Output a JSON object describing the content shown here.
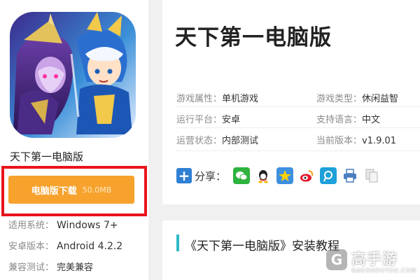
{
  "app": {
    "name": "天下第一电脑版"
  },
  "download": {
    "label": "电脑版下载",
    "size": "50.0MB"
  },
  "specs": [
    {
      "key": "适用系统：",
      "value": "Windows 7+"
    },
    {
      "key": "安卓版本：",
      "value": "Android 4.2.2"
    },
    {
      "key": "兼容测试：",
      "value": "完美兼容"
    }
  ],
  "info": {
    "title": "天下第一电脑版",
    "attributes": [
      {
        "key": "游戏属性：",
        "value": "单机游戏"
      },
      {
        "key": "游戏类型：",
        "value": "休闲益智"
      },
      {
        "key": "运行平台：",
        "value": "安卓"
      },
      {
        "key": "支持语言：",
        "value": "中文"
      },
      {
        "key": "运营状态：",
        "value": "内部测试"
      },
      {
        "key": "当前版本：",
        "value": "v1.9.01"
      }
    ],
    "share": {
      "plus": "+",
      "label": "分享：",
      "icons": [
        "wechat-icon",
        "qq-icon",
        "qzone-icon",
        "weibo-icon",
        "tencent-weibo-icon",
        "print-icon",
        "copy-icon"
      ]
    }
  },
  "tutorial": {
    "title": "《天下第一电脑版》安装教程"
  },
  "watermark": {
    "logo_char": "G",
    "text": "高手游",
    "sub": "GAOSHOUYOU.COM"
  },
  "colors": {
    "download_button": "#f6a22d",
    "highlight_frame": "#e8141b",
    "accent_bar": "#2fb8c6",
    "share_plus": "#2f7fd3"
  }
}
